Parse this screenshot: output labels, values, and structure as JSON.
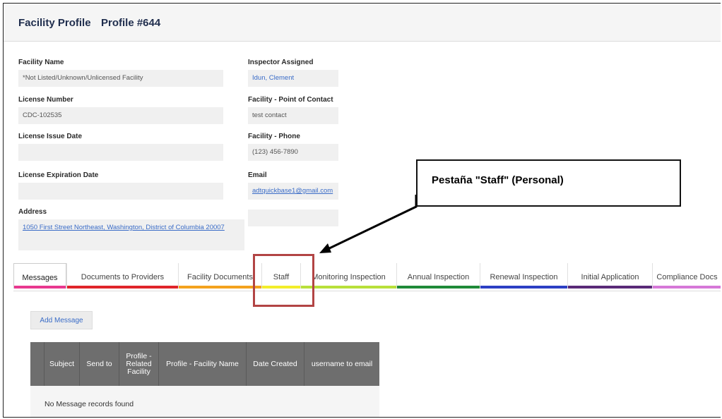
{
  "header": {
    "title": "Facility Profile",
    "profile_id": "Profile #644"
  },
  "fields": {
    "facility_name": {
      "label": "Facility Name",
      "value": "*Not Listed/Unknown/Unlicensed Facility"
    },
    "license_number": {
      "label": "License Number",
      "value": "CDC-102535"
    },
    "license_issue_date": {
      "label": "License Issue Date",
      "value": ""
    },
    "license_expiration_date": {
      "label": "License Expiration Date",
      "value": ""
    },
    "address": {
      "label": "Address",
      "value": "1050 First Street Northeast, Washington, District of Columbia 20007"
    },
    "inspector_assigned": {
      "label": "Inspector Assigned",
      "value": "Idun, Clement"
    },
    "point_of_contact": {
      "label": "Facility - Point of Contact",
      "value": "test contact"
    },
    "phone": {
      "label": "Facility - Phone",
      "value": "(123) 456-7890"
    },
    "email": {
      "label": "Email",
      "value": "adtquickbase1@gmail.com"
    },
    "extra": {
      "value": ""
    }
  },
  "tabs": [
    {
      "label": "Messages",
      "color": "#e8388f"
    },
    {
      "label": "Documents to Providers",
      "color": "#e0242a"
    },
    {
      "label": "Facility Documents",
      "color": "#f4a21d"
    },
    {
      "label": "Staff",
      "color": "#f3ee2a"
    },
    {
      "label": "Monitoring Inspection",
      "color": "#b8e03a"
    },
    {
      "label": "Annual Inspection",
      "color": "#1f8a38"
    },
    {
      "label": "Renewal Inspection",
      "color": "#2c3fc4"
    },
    {
      "label": "Initial Application",
      "color": "#5a2a78"
    },
    {
      "label": "Compliance Docs",
      "color": "#d678d8"
    }
  ],
  "callout": {
    "text": "Pestaña \"Staff\" (Personal)"
  },
  "messages": {
    "add_label": "Add Message",
    "columns": [
      "Subject",
      "Send to",
      "Profile - Related Facility",
      "Profile - Facility Name",
      "Date Created",
      "username to email"
    ],
    "empty_text": "No Message records found"
  }
}
